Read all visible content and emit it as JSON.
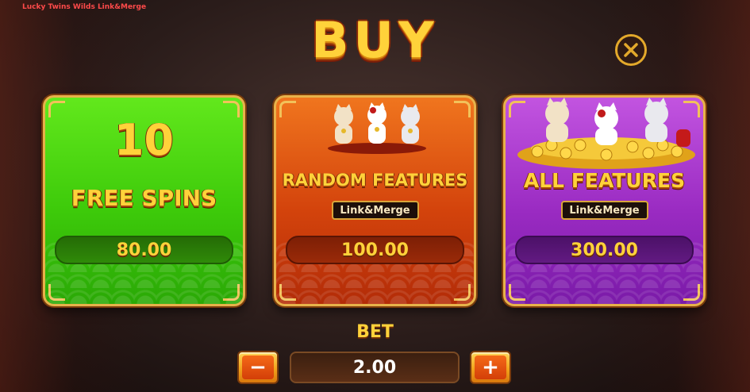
{
  "game": {
    "title": "Lucky Twins Wilds Link&Merge"
  },
  "header": {
    "title": "BUY",
    "close_icon": "close-x-icon"
  },
  "options": [
    {
      "id": "free-spins",
      "count": "10",
      "label": "FREE SPINS",
      "price": "80.00",
      "color": "#3dca0a"
    },
    {
      "id": "random-features",
      "label": "RANDOM FEATURES",
      "badge": "Link&Merge",
      "price": "100.00",
      "color": "#d3430c"
    },
    {
      "id": "all-features",
      "label": "ALL FEATURES",
      "badge": "Link&Merge",
      "price": "300.00",
      "color": "#9a2bc2"
    }
  ],
  "bet": {
    "label": "BET",
    "value": "2.00",
    "minus_label": "−",
    "plus_label": "+"
  },
  "colors": {
    "accent_gold": "#ffd23a",
    "title_red": "#ff4a4a"
  }
}
